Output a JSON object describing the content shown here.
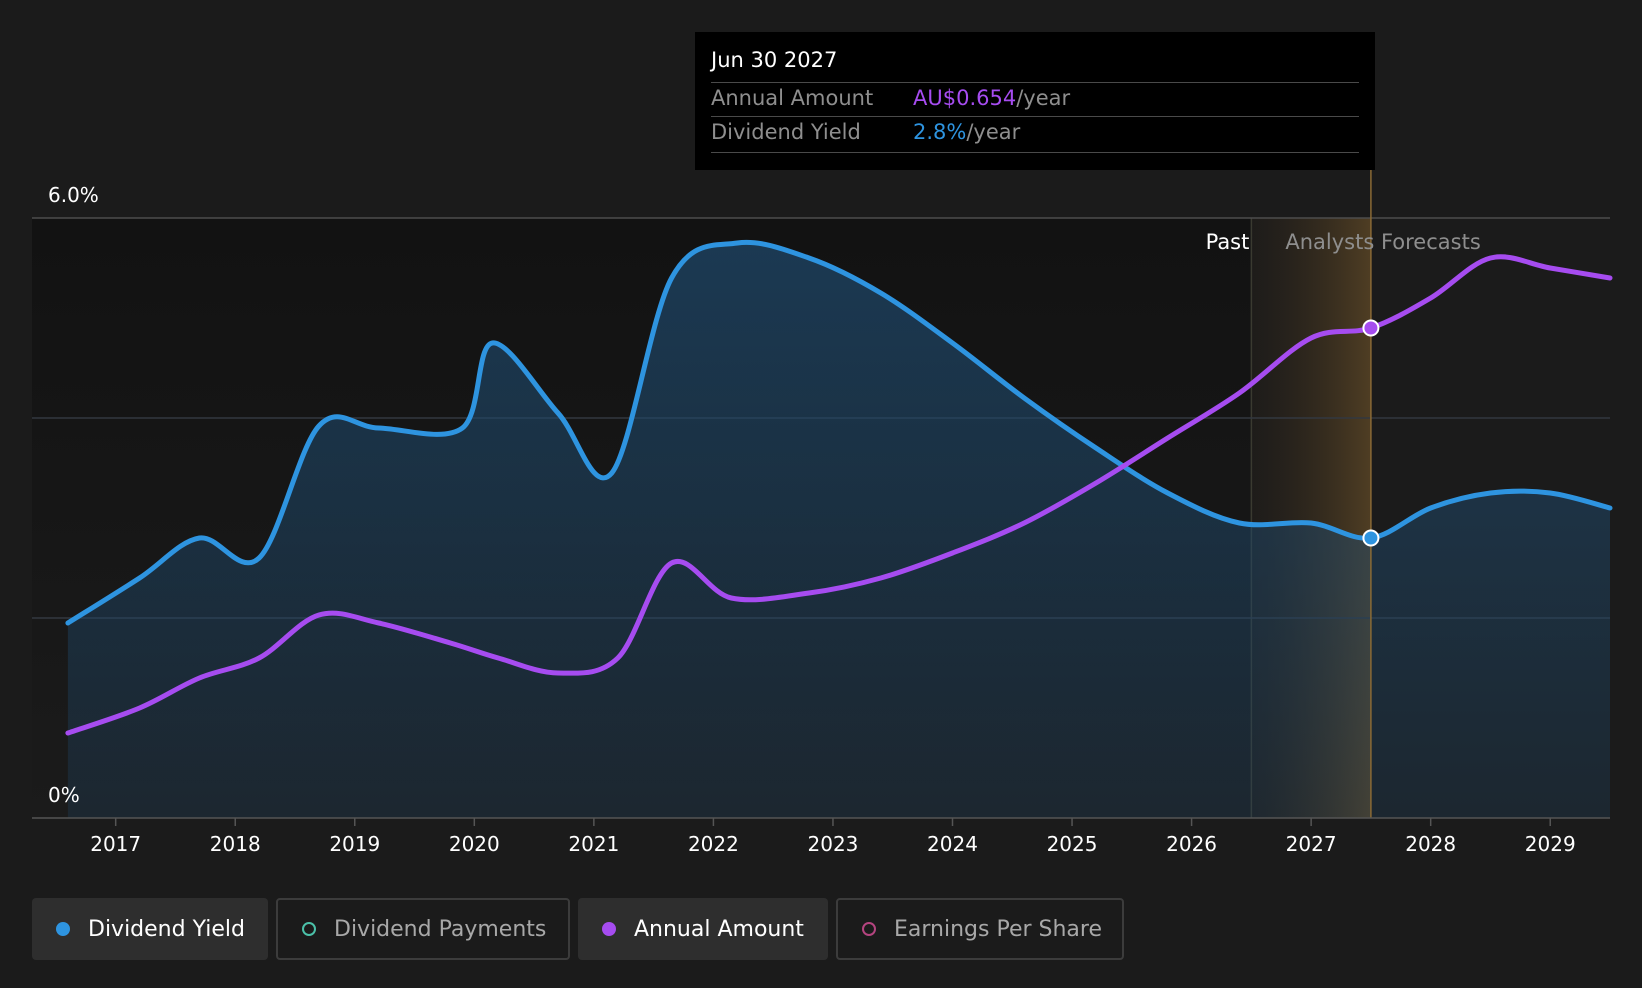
{
  "tooltip": {
    "date": "Jun 30 2027",
    "rows": [
      {
        "label": "Annual Amount",
        "value": "AU$0.654",
        "unit": "/year",
        "color": "#a64cf0"
      },
      {
        "label": "Dividend Yield",
        "value": "2.8%",
        "unit": "/year",
        "color": "#2e94e0"
      }
    ]
  },
  "regions": {
    "past": "Past",
    "forecast": "Analysts Forecasts"
  },
  "legend": [
    {
      "label": "Dividend Yield",
      "color": "#2e94e0",
      "active": true
    },
    {
      "label": "Dividend Payments",
      "color": "#4bc0a8",
      "active": false
    },
    {
      "label": "Annual Amount",
      "color": "#a64cf0",
      "active": true
    },
    {
      "label": "Earnings Per Share",
      "color": "#b4447f",
      "active": false
    }
  ],
  "chart_data": {
    "type": "line",
    "y_tick_labels": [
      "6.0%",
      "0%"
    ],
    "ylim": [
      0,
      6
    ],
    "xlim": [
      2016.3,
      2029.5
    ],
    "x_ticks": [
      "2017",
      "2018",
      "2019",
      "2020",
      "2021",
      "2022",
      "2023",
      "2024",
      "2025",
      "2026",
      "2027",
      "2028",
      "2029"
    ],
    "past_end": 2026.5,
    "highlight_x": 2027.5,
    "series": [
      {
        "name": "Dividend Yield",
        "color": "#2e94e0",
        "x": [
          2016.6,
          2017.2,
          2017.7,
          2018.2,
          2018.7,
          2019.2,
          2019.9,
          2020.15,
          2020.7,
          2021.15,
          2021.65,
          2022.2,
          2022.8,
          2023.4,
          2024.0,
          2024.6,
          2025.2,
          2025.8,
          2026.4,
          2027.0,
          2027.5,
          2028.0,
          2028.5,
          2029.0,
          2029.5
        ],
        "values": [
          1.95,
          2.4,
          2.8,
          2.6,
          3.92,
          3.9,
          3.9,
          4.75,
          4.05,
          3.45,
          5.4,
          5.75,
          5.6,
          5.25,
          4.75,
          4.2,
          3.7,
          3.25,
          2.95,
          2.95,
          2.8,
          3.1,
          3.25,
          3.25,
          3.1
        ]
      },
      {
        "name": "Annual Amount",
        "color": "#a64cf0",
        "x": [
          2016.6,
          2017.2,
          2017.7,
          2018.2,
          2018.7,
          2019.2,
          2019.8,
          2020.2,
          2020.7,
          2021.2,
          2021.65,
          2022.15,
          2022.8,
          2023.4,
          2024.0,
          2024.6,
          2025.2,
          2025.8,
          2026.4,
          2027.0,
          2027.5,
          2028.0,
          2028.5,
          2029.0,
          2029.5
        ],
        "values": [
          0.85,
          1.1,
          1.4,
          1.6,
          2.03,
          1.95,
          1.75,
          1.6,
          1.45,
          1.6,
          2.55,
          2.2,
          2.25,
          2.4,
          2.65,
          2.95,
          3.35,
          3.8,
          4.25,
          4.8,
          4.9,
          5.2,
          5.6,
          5.5,
          5.4
        ]
      }
    ]
  }
}
